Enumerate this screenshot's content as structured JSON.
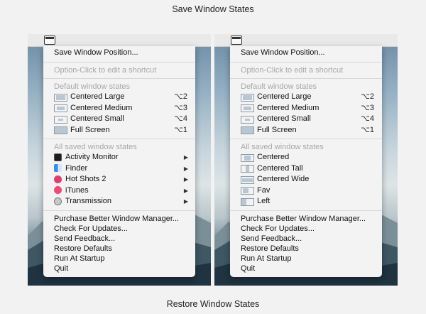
{
  "captions": {
    "top": "Save Window States",
    "bottom": "Restore Window States"
  },
  "menubar": {
    "icon": "window-states-icon"
  },
  "save_menu": {
    "save_position": "Save Window Position...",
    "option_click_hint": "Option-Click to edit a shortcut",
    "default_header": "Default window states",
    "defaults": [
      {
        "label": "Centered Large",
        "shortcut": "⌥2",
        "icon": "centered-large-icon"
      },
      {
        "label": "Centered Medium",
        "shortcut": "⌥3",
        "icon": "centered-medium-icon"
      },
      {
        "label": "Centered Small",
        "shortcut": "⌥4",
        "icon": "centered-small-icon"
      },
      {
        "label": "Full Screen",
        "shortcut": "⌥1",
        "icon": "full-screen-icon"
      }
    ],
    "saved_header": "All saved window states",
    "apps": [
      {
        "label": "Activity Monitor",
        "icon": "activity-monitor-icon"
      },
      {
        "label": "Finder",
        "icon": "finder-icon"
      },
      {
        "label": "Hot Shots 2",
        "icon": "hot-shots-icon"
      },
      {
        "label": "iTunes",
        "icon": "itunes-icon"
      },
      {
        "label": "Transmission",
        "icon": "transmission-icon"
      }
    ],
    "actions": [
      "Purchase Better Window Manager...",
      "Check For Updates...",
      "Send Feedback...",
      "Restore Defaults",
      "Run At Startup",
      "Quit"
    ]
  },
  "restore_menu": {
    "save_position": "Save Window Position...",
    "option_click_hint": "Option-Click to edit a shortcut",
    "default_header": "Default window states",
    "defaults": [
      {
        "label": "Centered Large",
        "shortcut": "⌥2",
        "icon": "centered-large-icon"
      },
      {
        "label": "Centered Medium",
        "shortcut": "⌥3",
        "icon": "centered-medium-icon"
      },
      {
        "label": "Centered Small",
        "shortcut": "⌥4",
        "icon": "centered-small-icon"
      },
      {
        "label": "Full Screen",
        "shortcut": "⌥1",
        "icon": "full-screen-icon"
      }
    ],
    "saved_header": "All saved window states",
    "states": [
      {
        "label": "Centered",
        "icon": "centered-icon"
      },
      {
        "label": "Centered Tall",
        "icon": "centered-tall-icon"
      },
      {
        "label": "Centered Wide",
        "icon": "centered-wide-icon"
      },
      {
        "label": "Fav",
        "icon": "fav-icon"
      },
      {
        "label": "Left",
        "icon": "left-icon"
      }
    ],
    "actions": [
      "Purchase Better Window Manager...",
      "Check For Updates...",
      "Send Feedback...",
      "Restore Defaults",
      "Run At Startup",
      "Quit"
    ]
  },
  "submenu_glyph": "▶",
  "colors": {
    "menu_bg": "#f3f3f3",
    "disabled_text": "#a8a8a8",
    "page_bg": "#f2f2f2"
  }
}
